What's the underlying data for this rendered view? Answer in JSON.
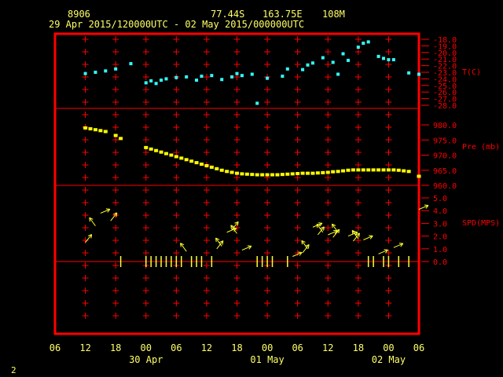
{
  "header": {
    "station": "8906",
    "lat": "77.44S",
    "lon": "163.75E",
    "elev": "108M",
    "period": "29 Apr 2015/120000UTC - 02 May 2015/000000UTC"
  },
  "colors": {
    "background": "#000000",
    "frame": "#ff0000",
    "text": "#ffff66",
    "temperature": "#33ffff",
    "pressure": "#ffff00",
    "wind": "#ffff33"
  },
  "footer_label": "2",
  "chart_data": [
    {
      "type": "scatter",
      "panel": "temperature",
      "ylabel": "T(C)",
      "ylim": [
        -28,
        -18
      ],
      "ytick_labels": [
        "-18.0",
        "-19.0",
        "-20.0",
        "-21.0",
        "-22.0",
        "-23.0",
        "-24.0",
        "-25.0",
        "-26.0",
        "-27.0",
        "-28.0"
      ],
      "x_hours": [
        12,
        14,
        16,
        18,
        21,
        24,
        25,
        26,
        27,
        28,
        30,
        32,
        34,
        35,
        37,
        39,
        41,
        42,
        43,
        45,
        46,
        48,
        51,
        52,
        55,
        56,
        57,
        59,
        61,
        62,
        63,
        64,
        66,
        67,
        68,
        70,
        71,
        72,
        73,
        76,
        78
      ],
      "values": [
        -23.2,
        -23.0,
        -22.8,
        -22.5,
        -21.7,
        -24.6,
        -24.3,
        -24.7,
        -24.2,
        -24.0,
        -23.8,
        -23.7,
        -24.2,
        -23.6,
        -23.5,
        -24.1,
        -23.7,
        -23.2,
        -23.5,
        -23.3,
        -27.7,
        -23.9,
        -23.6,
        -22.5,
        -22.6,
        -21.9,
        -21.6,
        -20.8,
        -21.5,
        -23.3,
        -20.2,
        -21.2,
        -19.2,
        -18.6,
        -18.4,
        -20.6,
        -20.9,
        -21.1,
        -21.1,
        -23.1,
        -23.3
      ]
    },
    {
      "type": "scatter",
      "panel": "pressure",
      "ylabel": "Pre (mb)",
      "ylim": [
        960,
        985
      ],
      "ytick_labels": [
        "980.0",
        "975.0",
        "970.0",
        "965.0",
        "960.0"
      ],
      "x_hours": [
        12,
        13,
        14,
        15,
        16,
        18,
        19,
        24,
        25,
        26,
        27,
        28,
        29,
        30,
        31,
        32,
        33,
        34,
        35,
        36,
        37,
        38,
        39,
        40,
        41,
        42,
        43,
        44,
        45,
        46,
        47,
        48,
        49,
        50,
        51,
        52,
        53,
        54,
        55,
        56,
        57,
        58,
        59,
        60,
        61,
        62,
        63,
        64,
        65,
        66,
        67,
        68,
        69,
        70,
        71,
        72,
        73,
        74,
        75,
        76,
        78
      ],
      "values": [
        979,
        978.7,
        978.4,
        978.1,
        977.8,
        976.5,
        975.5,
        972.5,
        972,
        971.5,
        971,
        970.5,
        970,
        969.5,
        969,
        968.5,
        968,
        967.5,
        967,
        966.5,
        966,
        965.5,
        965,
        964.6,
        964.3,
        964,
        963.8,
        963.7,
        963.6,
        963.5,
        963.5,
        963.5,
        963.5,
        963.5,
        963.6,
        963.7,
        963.8,
        963.9,
        964,
        964,
        964,
        964.1,
        964.2,
        964.3,
        964.5,
        964.6,
        964.8,
        965,
        965.1,
        965.1,
        965.1,
        965.1,
        965.1,
        965.1,
        965.1,
        965.1,
        965.1,
        965,
        964.8,
        964.6,
        963
      ]
    },
    {
      "type": "scatter",
      "panel": "wind",
      "ylabel": "SPD(MPS)",
      "ylim": [
        0,
        5
      ],
      "ytick_labels": [
        "5.0",
        "4.0",
        "3.0",
        "2.0",
        "1.0",
        "0.0"
      ],
      "x_hours": [
        12,
        14,
        15,
        17,
        19,
        24,
        25,
        26,
        27,
        28,
        29,
        30,
        31,
        32,
        33,
        34,
        35,
        37,
        38,
        39,
        40,
        41,
        42,
        43,
        46,
        47,
        48,
        49,
        52,
        53,
        55,
        56,
        57,
        58,
        59,
        60,
        61,
        62,
        64,
        65,
        66,
        67,
        68,
        69,
        70,
        71,
        72,
        73,
        74,
        76,
        78
      ],
      "values": [
        1.5,
        2.8,
        3.8,
        3.2,
        0,
        0,
        0,
        0,
        0,
        0,
        0,
        0,
        0,
        0.8,
        0,
        0,
        0,
        0,
        1.0,
        1.2,
        2.3,
        2.5,
        2.2,
        0.9,
        0,
        0,
        0,
        0,
        0,
        0.4,
        0.7,
        1.0,
        2.7,
        2.1,
        2.3,
        2.1,
        1.9,
        2.3,
        2.0,
        1.6,
        1.8,
        1.7,
        0,
        0,
        0.6,
        0,
        0,
        1.1,
        0,
        0,
        4.1
      ]
    }
  ],
  "x_axis": {
    "tick_labels": [
      "06",
      "12",
      "18",
      "00",
      "06",
      "12",
      "18",
      "00",
      "06",
      "12",
      "18",
      "00",
      "06"
    ],
    "tick_hours": [
      6,
      12,
      18,
      24,
      30,
      36,
      42,
      48,
      54,
      60,
      66,
      72,
      78
    ],
    "date_labels": [
      {
        "text": "30 Apr",
        "hour": 24
      },
      {
        "text": "01 May",
        "hour": 48
      },
      {
        "text": "02 May",
        "hour": 72
      }
    ]
  }
}
